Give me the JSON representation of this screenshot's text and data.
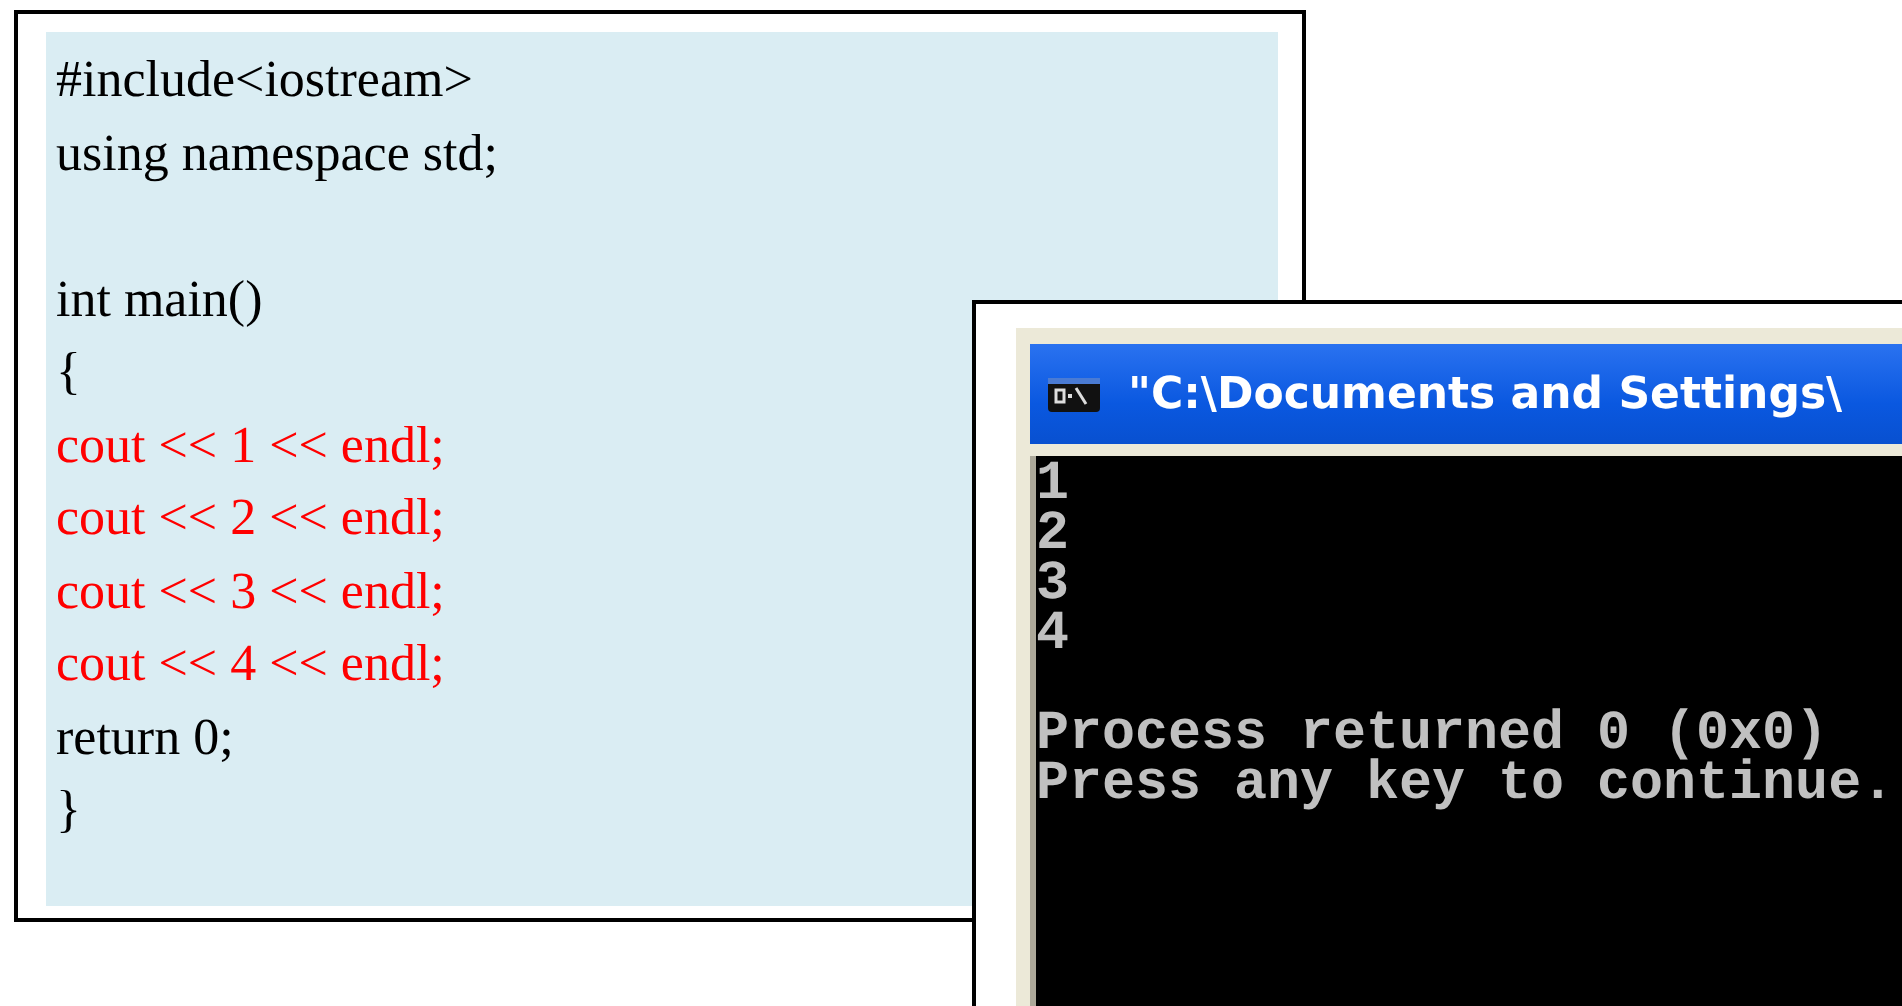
{
  "code_listing": {
    "lines": [
      {
        "kind": "code",
        "text": "#include<iostream>",
        "highlighted": false
      },
      {
        "kind": "code",
        "text": "using namespace std;",
        "highlighted": false
      },
      {
        "kind": "blank"
      },
      {
        "kind": "code",
        "text": "int main()",
        "highlighted": false
      },
      {
        "kind": "code",
        "text": "{",
        "highlighted": false
      },
      {
        "kind": "code",
        "text": "cout << 1 << endl;",
        "highlighted": true
      },
      {
        "kind": "code",
        "text": "cout << 2 << endl;",
        "highlighted": true
      },
      {
        "kind": "code",
        "text": "cout << 3 << endl;",
        "highlighted": true
      },
      {
        "kind": "code",
        "text": "cout << 4 << endl;",
        "highlighted": true
      },
      {
        "kind": "code",
        "text": "return 0;",
        "highlighted": false
      },
      {
        "kind": "code",
        "text": "}",
        "highlighted": false
      }
    ]
  },
  "console_window": {
    "title": "\"C:\\Documents and Settings\\",
    "output": [
      {
        "kind": "text",
        "text": "1"
      },
      {
        "kind": "text",
        "text": "2"
      },
      {
        "kind": "text",
        "text": "3"
      },
      {
        "kind": "text",
        "text": "4"
      },
      {
        "kind": "blank"
      },
      {
        "kind": "text",
        "text": "Process returned 0 (0x0)"
      },
      {
        "kind": "text",
        "text": "Press any key to continue."
      }
    ]
  }
}
